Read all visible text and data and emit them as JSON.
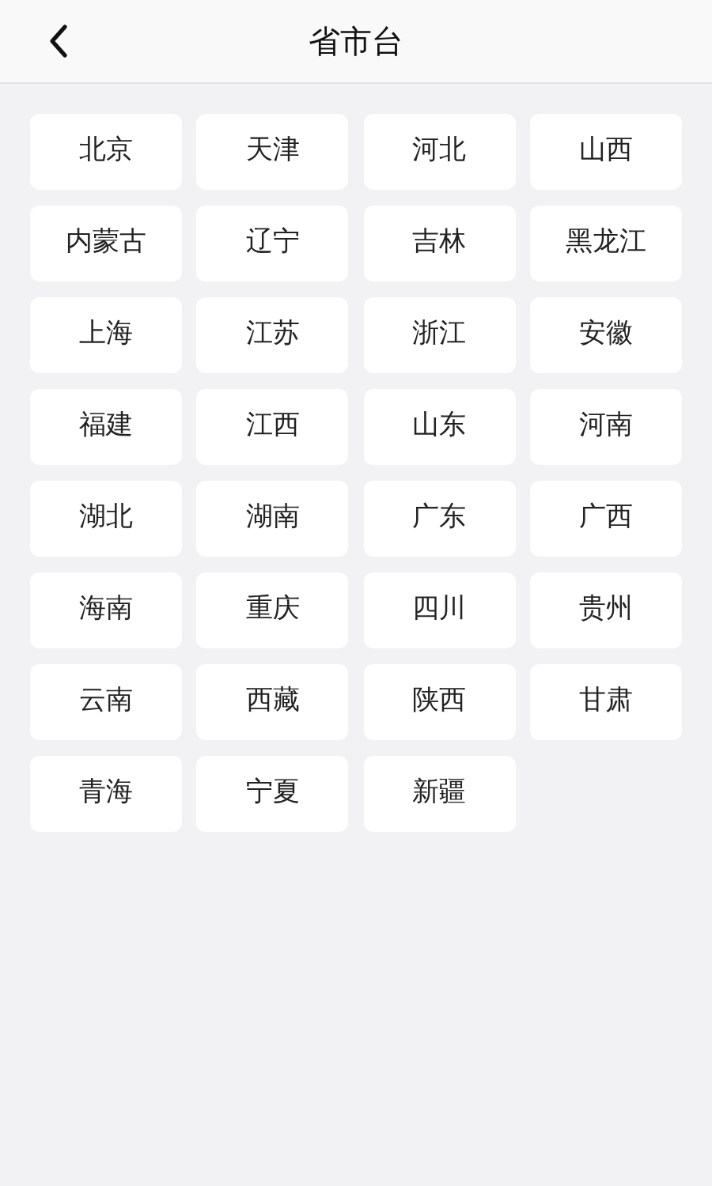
{
  "header": {
    "title": "省市台"
  },
  "provinces": [
    "北京",
    "天津",
    "河北",
    "山西",
    "内蒙古",
    "辽宁",
    "吉林",
    "黑龙江",
    "上海",
    "江苏",
    "浙江",
    "安徽",
    "福建",
    "江西",
    "山东",
    "河南",
    "湖北",
    "湖南",
    "广东",
    "广西",
    "海南",
    "重庆",
    "四川",
    "贵州",
    "云南",
    "西藏",
    "陕西",
    "甘肃",
    "青海",
    "宁夏",
    "新疆"
  ]
}
